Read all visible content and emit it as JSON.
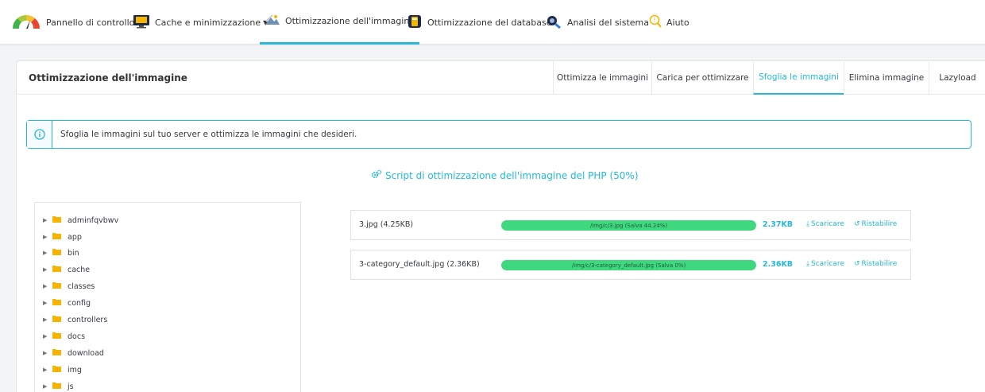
{
  "nav": {
    "items": [
      {
        "label": "Pannello di controllo",
        "icon": "gauge-icon"
      },
      {
        "label": "Cache e minimizzazione",
        "icon": "monitor-icon"
      },
      {
        "label": "Ottimizzazione dell'immagine",
        "icon": "image-optimize-icon"
      },
      {
        "label": "Ottimizzazione del database",
        "icon": "database-icon"
      },
      {
        "label": "Analisi del sistema",
        "icon": "system-analysis-icon"
      },
      {
        "label": "Aiuto",
        "icon": "help-icon"
      }
    ],
    "active": "Ottimizzazione dell'immagine"
  },
  "panel": {
    "title": "Ottimizzazione dell'immagine",
    "tabs": [
      {
        "label": "Ottimizza le immagini"
      },
      {
        "label": "Carica per ottimizzare"
      },
      {
        "label": "Sfoglia le immagini"
      },
      {
        "label": "Elimina immagine"
      },
      {
        "label": "Lazyload"
      }
    ],
    "active_tab": "Sfoglia le immagini"
  },
  "info": {
    "text": "Sfoglia le immagini sul tuo server e ottimizza le immagini che desideri."
  },
  "script_link": {
    "label": "Script di ottimizzazione dell'immagine del PHP (50%)"
  },
  "tree": {
    "folders": [
      "adminfqvbwv",
      "app",
      "bin",
      "cache",
      "classes",
      "config",
      "controllers",
      "docs",
      "download",
      "img",
      "js"
    ]
  },
  "images": [
    {
      "name": "3.jpg (4.25KB)",
      "progress_text": "/img/c/3.jpg (Salva 44.24%)",
      "progress": 100,
      "new_size": "2.37KB",
      "download_label": "Scaricare",
      "restore_label": "Ristabilire"
    },
    {
      "name": "3-category_default.jpg (2.36KB)",
      "progress_text": "/img/c/3-category_default.jpg (Salva 0%)",
      "progress": 100,
      "new_size": "2.36KB",
      "download_label": "Scaricare",
      "restore_label": "Ristabilire"
    }
  ],
  "colors": {
    "accent": "#25b9d7",
    "progress": "#3fd87f",
    "folder": "#f5b400"
  }
}
